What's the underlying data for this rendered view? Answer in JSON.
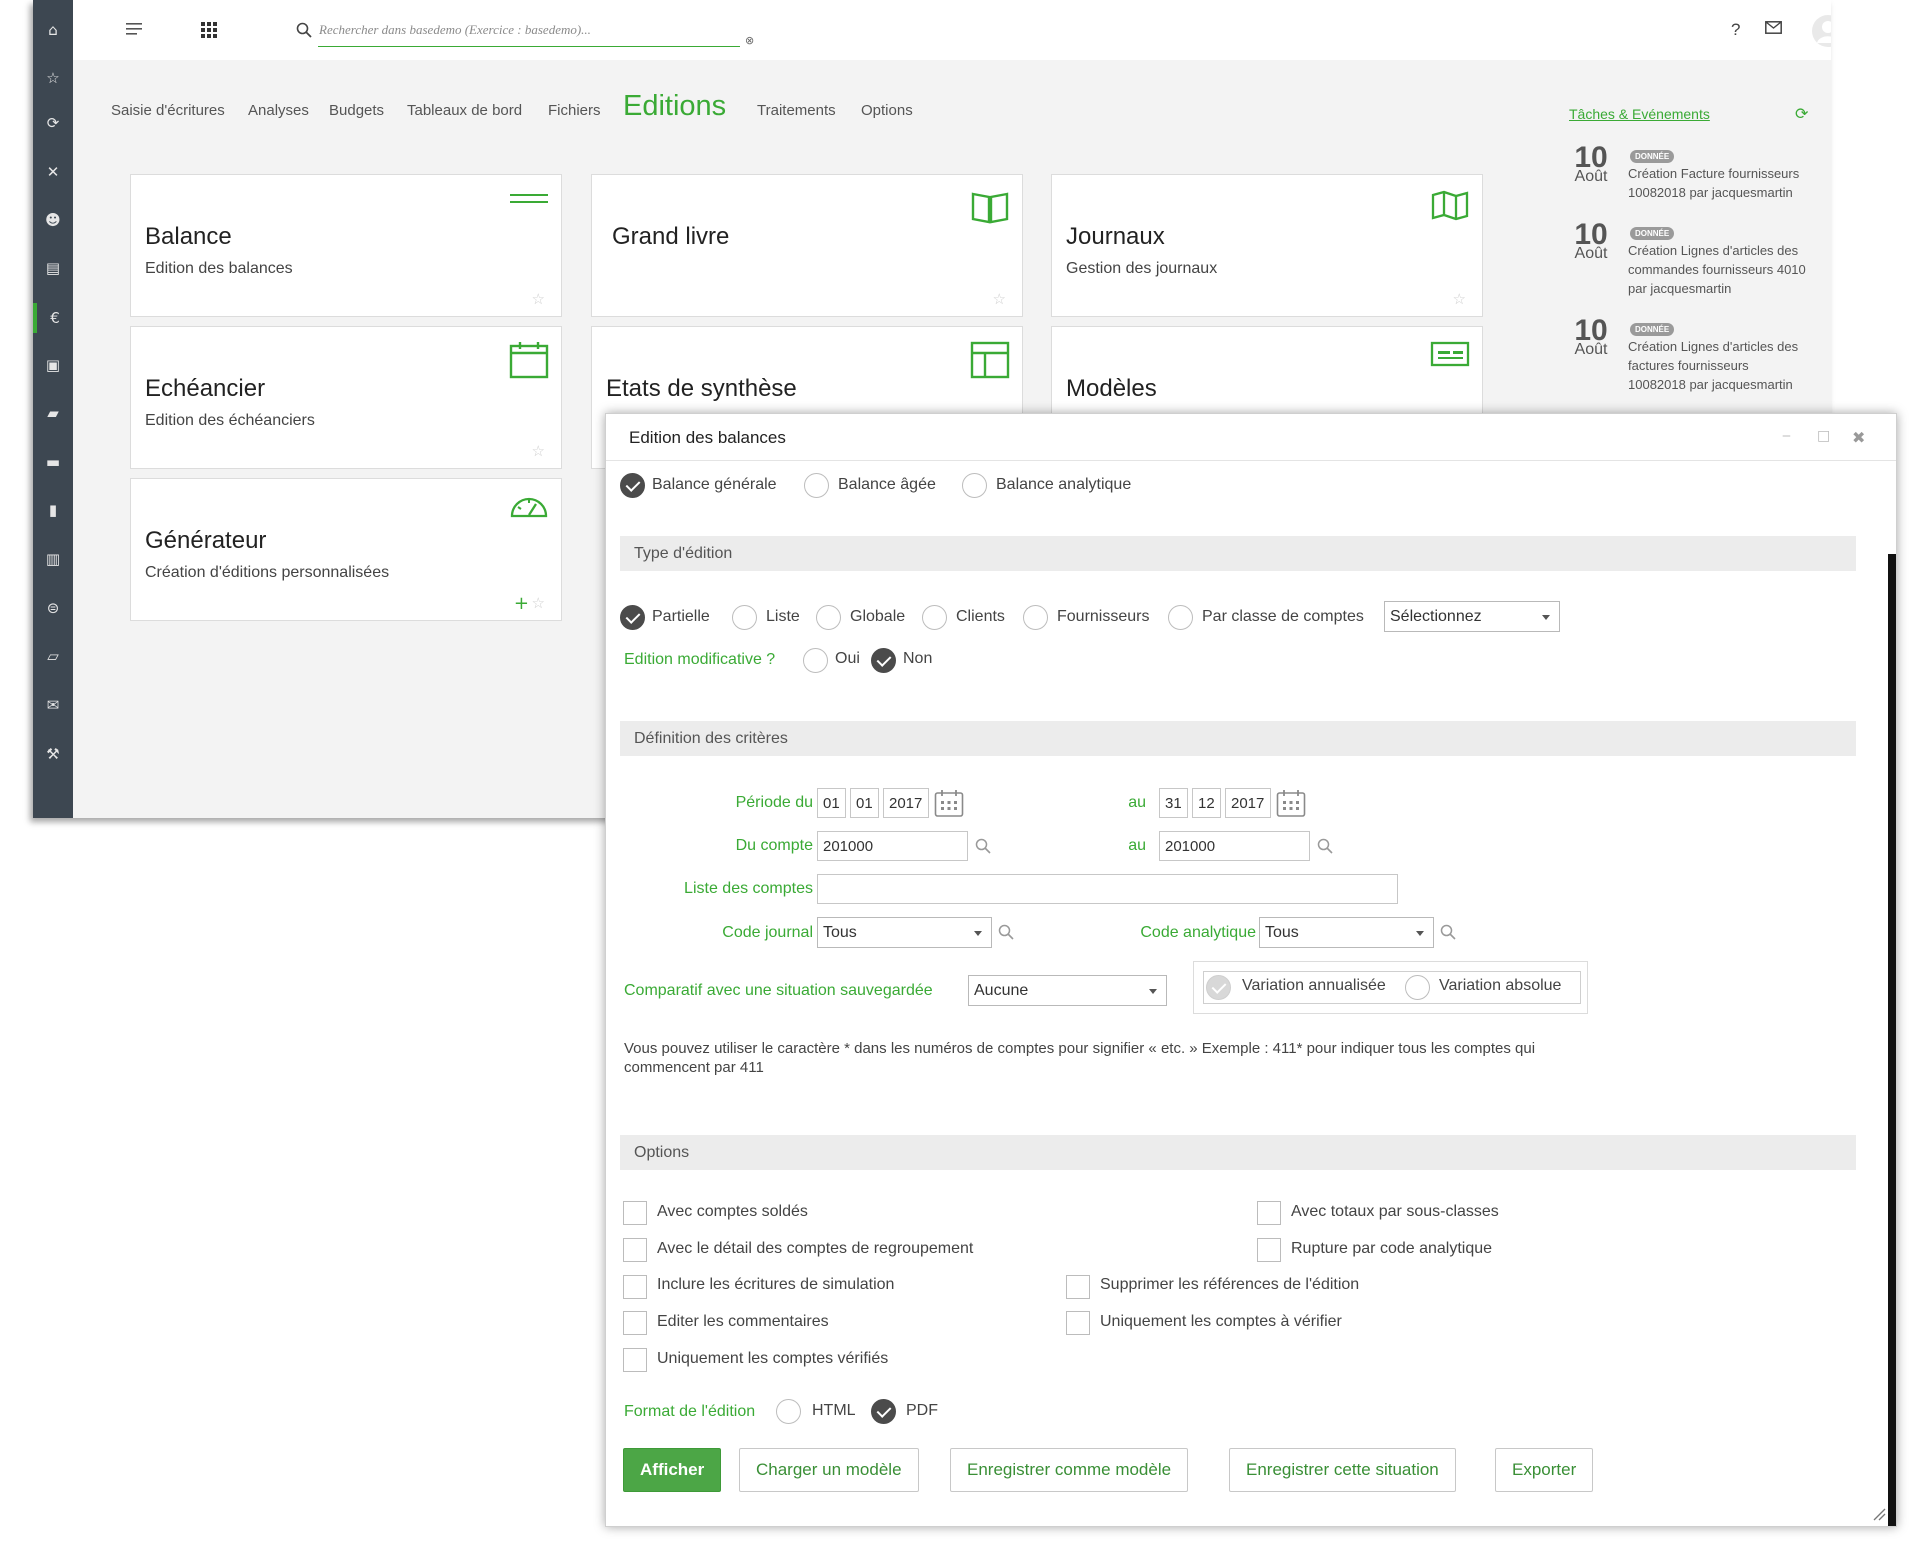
{
  "colors": {
    "accent": "#3aaa35",
    "sidebar": "#3d4751",
    "primary_button": "#4ca646"
  },
  "sidebar": {
    "icons": [
      "home-icon",
      "star-icon",
      "sync-icon",
      "tools-icon",
      "users-icon",
      "document-clock-icon",
      "euro-icon",
      "calendar-euro-icon",
      "wallet-icon",
      "card-icon",
      "ledger-icon",
      "report-icon",
      "cycle-icon",
      "folder-icon",
      "mail-settings-icon",
      "wrench-icon"
    ]
  },
  "topbar": {
    "search_placeholder": "Rechercher dans basedemo (Exercice : basedemo)...",
    "help": "?"
  },
  "nav": {
    "items": [
      "Saisie d'écritures",
      "Analyses",
      "Budgets",
      "Tableaux de bord",
      "Fichiers",
      "Editions",
      "Traitements",
      "Options"
    ],
    "active": "Editions"
  },
  "cards": [
    {
      "title": "Balance",
      "subtitle": "Edition des balances",
      "icon": "balance-lines-icon"
    },
    {
      "title": "Grand livre",
      "subtitle": "",
      "icon": "open-book-icon"
    },
    {
      "title": "Journaux",
      "subtitle": "Gestion des journaux",
      "icon": "map-book-icon"
    },
    {
      "title": "Echéancier",
      "subtitle": "Edition des échéanciers",
      "icon": "calendar-icon"
    },
    {
      "title": "Etats de synthèse",
      "subtitle": "",
      "icon": "layout-icon"
    },
    {
      "title": "Modèles",
      "subtitle": "",
      "icon": "template-card-icon"
    },
    {
      "title": "Générateur",
      "subtitle": "Création d'éditions personnalisées",
      "icon": "gauge-icon"
    }
  ],
  "tasks": {
    "title": "Tâches & Evénements",
    "items": [
      {
        "day": "10",
        "month": "Août",
        "badge": "DONNÉE",
        "text": "Création Facture fournisseurs 10082018 par jacquesmartin"
      },
      {
        "day": "10",
        "month": "Août",
        "badge": "DONNÉE",
        "text": "Création Lignes d'articles des commandes fournisseurs 4010 par jacquesmartin"
      },
      {
        "day": "10",
        "month": "Août",
        "badge": "DONNÉE",
        "text": "Création Lignes d'articles des factures fournisseurs 10082018 par jacquesmartin"
      }
    ]
  },
  "dialog": {
    "title": "Edition des balances",
    "balance_types": [
      {
        "label": "Balance générale",
        "checked": true
      },
      {
        "label": "Balance âgée",
        "checked": false
      },
      {
        "label": "Balance analytique",
        "checked": false
      }
    ],
    "section_type": "Type d'édition",
    "edition_types": [
      {
        "label": "Partielle",
        "checked": true
      },
      {
        "label": "Liste",
        "checked": false
      },
      {
        "label": "Globale",
        "checked": false
      },
      {
        "label": "Clients",
        "checked": false
      },
      {
        "label": "Fournisseurs",
        "checked": false
      },
      {
        "label": "Par classe de comptes",
        "checked": false
      }
    ],
    "classe_select": "Sélectionnez",
    "modificative": {
      "label": "Edition modificative ?",
      "oui": "Oui",
      "non": "Non",
      "value": "Non"
    },
    "section_criteria": "Définition des critères",
    "periode": {
      "label": "Période du",
      "from": {
        "day": "01",
        "month": "01",
        "year": "2017"
      },
      "to_label": "au",
      "to": {
        "day": "31",
        "month": "12",
        "year": "2017"
      }
    },
    "compte": {
      "label": "Du compte",
      "from": "201000",
      "to_label": "au",
      "to": "201000"
    },
    "liste_comptes": {
      "label": "Liste des comptes",
      "value": ""
    },
    "code_journal": {
      "label": "Code journal",
      "value": "Tous"
    },
    "code_analytique": {
      "label": "Code analytique",
      "value": "Tous"
    },
    "comparatif": {
      "label": "Comparatif avec une situation sauvegardée",
      "value": "Aucune"
    },
    "variation": {
      "annualisee": "Variation annualisée",
      "absolue": "Variation absolue"
    },
    "hint": "Vous pouvez utiliser le caractère * dans les numéros de comptes pour signifier « etc. » Exemple : 411* pour indiquer tous les comptes qui commencent par 411",
    "section_options": "Options",
    "options_left": [
      "Avec comptes soldés",
      "Avec le détail des comptes de regroupement",
      "Inclure les écritures de simulation",
      "Editer les commentaires",
      "Uniquement les comptes vérifiés"
    ],
    "options_right": [
      "Avec totaux par sous-classes",
      "Rupture par code analytique",
      "Supprimer les références de l'édition",
      "Uniquement les comptes à vérifier"
    ],
    "format": {
      "label": "Format de l'édition",
      "html": "HTML",
      "pdf": "PDF",
      "value": "PDF"
    },
    "buttons": {
      "afficher": "Afficher",
      "charger": "Charger un modèle",
      "enregistrer_modele": "Enregistrer comme modèle",
      "enregistrer_situation": "Enregistrer cette situation",
      "exporter": "Exporter"
    }
  }
}
